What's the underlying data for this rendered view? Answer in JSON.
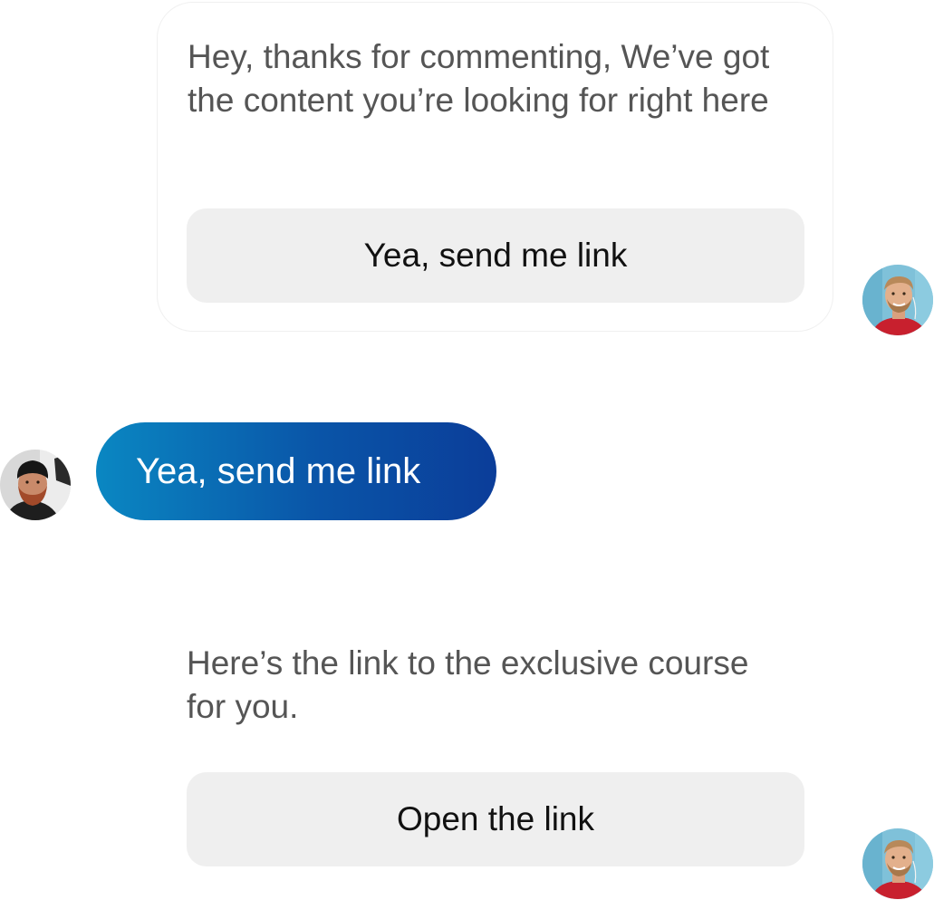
{
  "messages": {
    "first": {
      "text": "Hey, thanks for commenting, We’ve got the content you’re looking for right here",
      "button_label": "Yea, send me link"
    },
    "reply": {
      "text": "Yea, send me link"
    },
    "second": {
      "text": "Here’s the link to the exclusive course for you.",
      "button_label": "Open the link"
    }
  },
  "avatars": {
    "bot": "bot-avatar-man-with-beard-red-shirt",
    "user": "user-avatar-man-with-beanie-beard"
  },
  "colors": {
    "reply_gradient_start": "#0a87c2",
    "reply_gradient_end": "#0b3d99",
    "button_bg": "#efefef",
    "message_text": "#555555"
  }
}
